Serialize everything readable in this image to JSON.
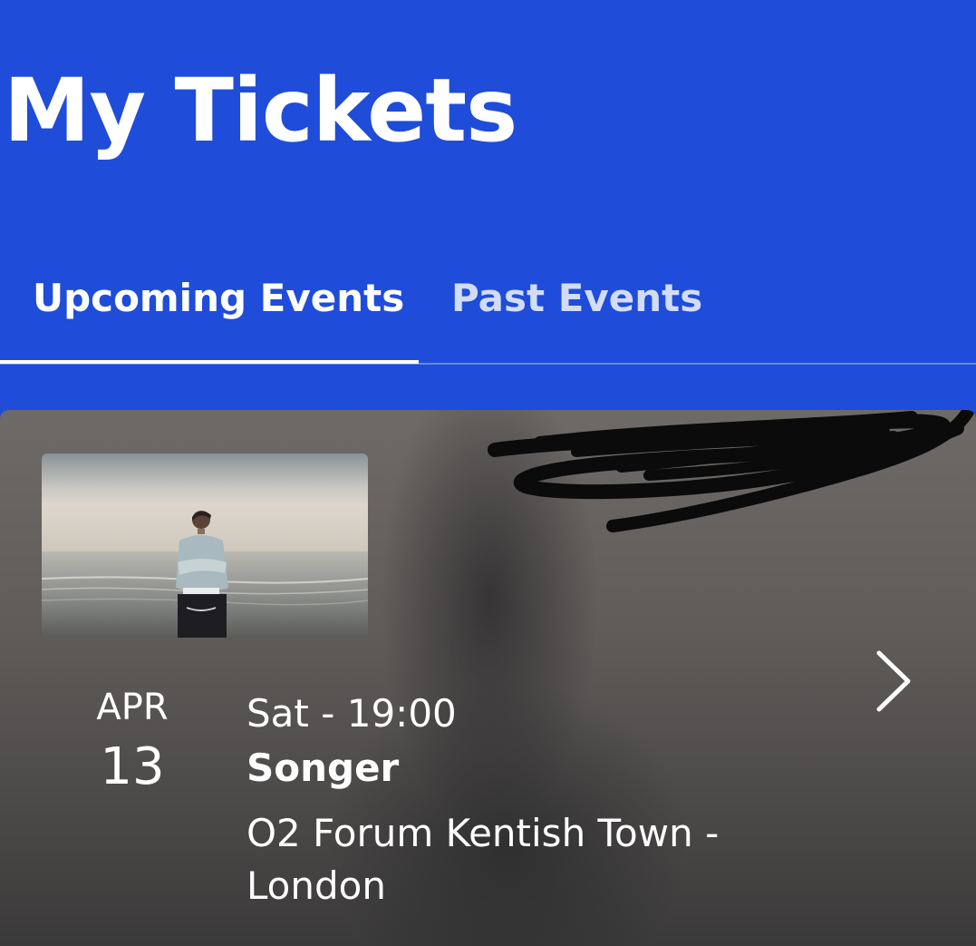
{
  "header": {
    "title": "My Tickets"
  },
  "tabs": [
    {
      "label": "Upcoming Events",
      "active": true
    },
    {
      "label": "Past Events",
      "active": false
    }
  ],
  "event": {
    "month": "APR",
    "day": "13",
    "time": "Sat - 19:00",
    "name": "Songer",
    "venue": "O2 Forum Kentish Town - London"
  },
  "colors": {
    "header_bg": "#1f4dd9",
    "active_tab": "#ffffff",
    "inactive_tab": "#d2dcf7"
  },
  "icons": {
    "chevron": "chevron-right-icon"
  }
}
